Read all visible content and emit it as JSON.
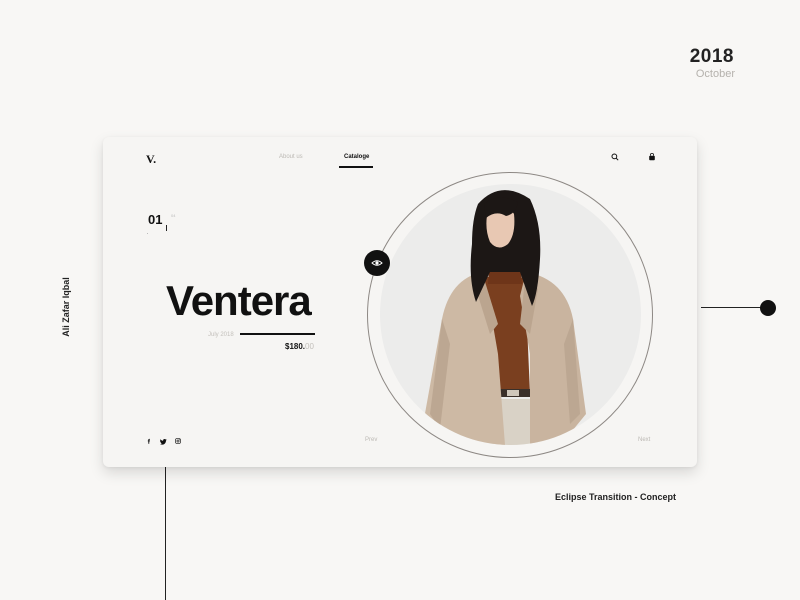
{
  "meta": {
    "year": "2018",
    "month": "October",
    "author": "Ali Zafar Iqbal",
    "concept": "Eclipse Transition - Concept"
  },
  "card": {
    "logo": "V.",
    "nav": {
      "about": "About us",
      "catalog": "Cataloge"
    },
    "icons": {
      "search": "search-icon",
      "bag": "bag-icon",
      "eye": "eye-icon"
    },
    "slide": {
      "number": "01",
      "total": "04"
    },
    "product": {
      "name": "Ventera",
      "date": "July 2018",
      "price_main": "$180.",
      "price_decimals": "00"
    },
    "social": [
      "facebook-icon",
      "twitter-icon",
      "instagram-icon"
    ],
    "pager": {
      "prev": "Prev",
      "next": "Next"
    }
  },
  "colors": {
    "background": "#f8f7f5",
    "card": "#f6f5f3",
    "accent": "#111111",
    "muted": "#bcb9b4",
    "coat": "#cdb9a4",
    "sweater": "#7a3f1f"
  }
}
